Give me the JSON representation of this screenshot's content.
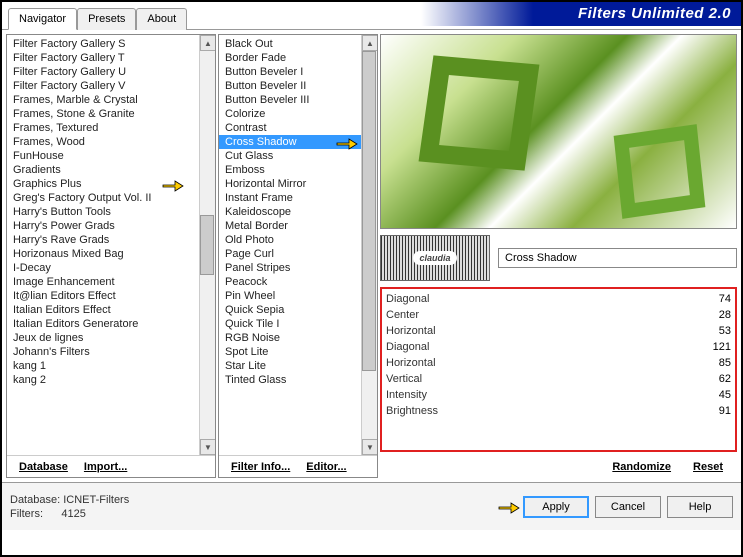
{
  "title": "Filters Unlimited 2.0",
  "tabs": [
    "Navigator",
    "Presets",
    "About"
  ],
  "activeTab": 0,
  "categories": [
    "Filter Factory Gallery S",
    "Filter Factory Gallery T",
    "Filter Factory Gallery U",
    "Filter Factory Gallery V",
    "Frames, Marble & Crystal",
    "Frames, Stone & Granite",
    "Frames, Textured",
    "Frames, Wood",
    "FunHouse",
    "Gradients",
    "Graphics Plus",
    "Greg's Factory Output Vol. II",
    "Harry's Button Tools",
    "Harry's Power Grads",
    "Harry's Rave Grads",
    "Horizonaus Mixed Bag",
    "I-Decay",
    "Image Enhancement",
    "It@lian Editors Effect",
    "Italian Editors Effect",
    "Italian Editors Generatore",
    "Jeux de lignes",
    "Johann's Filters",
    "kang 1",
    "kang 2"
  ],
  "category_hand_index": 10,
  "filters": [
    "Black Out",
    "Border Fade",
    "Button Beveler I",
    "Button Beveler II",
    "Button Beveler III",
    "Colorize",
    "Contrast",
    "Cross Shadow",
    "Cut Glass",
    "Emboss",
    "Horizontal Mirror",
    "Instant Frame",
    "Kaleidoscope",
    "Metal Border",
    "Old Photo",
    "Page Curl",
    "Panel Stripes",
    "Peacock",
    "Pin Wheel",
    "Quick Sepia",
    "Quick Tile I",
    "RGB Noise",
    "Spot Lite",
    "Star Lite",
    "Tinted Glass"
  ],
  "selected_filter_index": 7,
  "col1_actions": {
    "db": "Database",
    "imp": "Import..."
  },
  "col2_actions": {
    "info": "Filter Info...",
    "edit": "Editor..."
  },
  "logo_text": "claudia",
  "selected_filter_name": "Cross Shadow",
  "params": [
    {
      "label": "Diagonal",
      "value": 74
    },
    {
      "label": "Center",
      "value": 28
    },
    {
      "label": "Horizontal",
      "value": 53
    },
    {
      "label": "Diagonal",
      "value": 121
    },
    {
      "label": "Horizontal",
      "value": 85
    },
    {
      "label": "Vertical",
      "value": 62
    },
    {
      "label": "Intensity",
      "value": 45
    },
    {
      "label": "Brightness",
      "value": 91
    }
  ],
  "preview_actions": {
    "rand": "Randomize",
    "reset": "Reset"
  },
  "footer": {
    "db_label": "Database:",
    "db_val": "ICNET-Filters",
    "filt_label": "Filters:",
    "filt_val": "4125"
  },
  "buttons": {
    "apply": "Apply",
    "cancel": "Cancel",
    "help": "Help"
  }
}
